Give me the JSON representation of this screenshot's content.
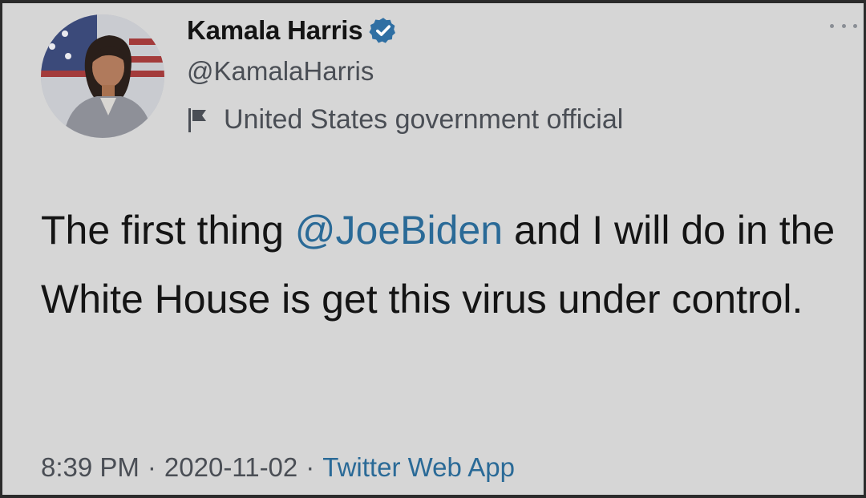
{
  "tweet": {
    "author": {
      "display_name": "Kamala Harris",
      "handle": "@KamalaHarris",
      "verified": true,
      "verified_icon": "verified-badge-icon",
      "label": "United States government official",
      "label_icon": "flag-icon"
    },
    "text": {
      "part1": "The first thing ",
      "mention": "@JoeBiden",
      "part2": " and I will do in the White House is get this virus under control."
    },
    "meta": {
      "time": "8:39 PM",
      "separator": "·",
      "date": "2020-11-02",
      "source": "Twitter Web App"
    },
    "more_icon": "more-options-icon"
  },
  "colors": {
    "background": "#d6d6d6",
    "text": "#141414",
    "secondary_text": "#4a4e55",
    "link": "#2a6a97",
    "verified": "#2f6fa3"
  }
}
